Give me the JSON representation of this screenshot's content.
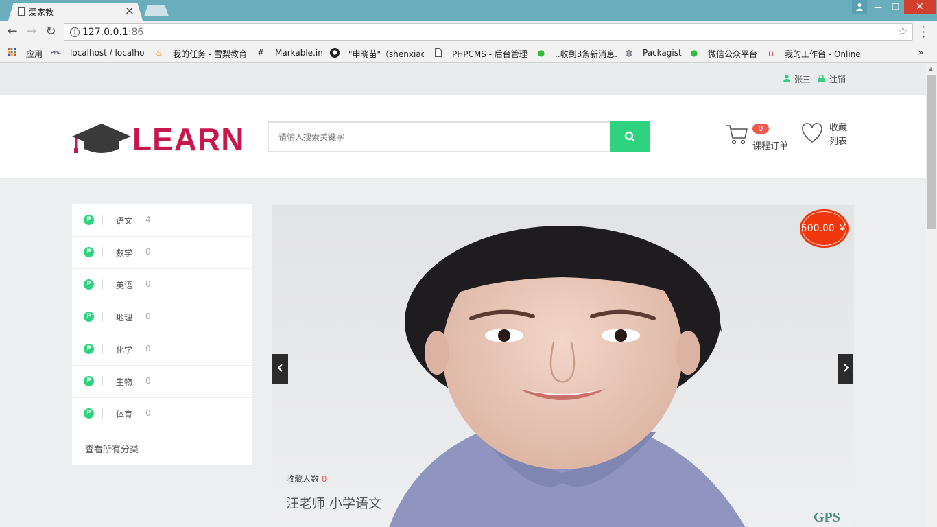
{
  "browser": {
    "tab_title": "爱家教",
    "url_host": "127.0.0.1",
    "url_port": ":86",
    "bookmarks": [
      {
        "label": "应用",
        "icon": "apps-grid-icon"
      },
      {
        "label": "localhost / localhos",
        "icon": "phpmyadmin-icon"
      },
      {
        "label": "我的任务 - 雪梨教育",
        "icon": "flame-icon"
      },
      {
        "label": "Markable.in",
        "icon": "hash-icon"
      },
      {
        "label": "\"申晓苗\"（shenxiao",
        "icon": "github-icon"
      },
      {
        "label": "PHPCMS - 后台管理",
        "icon": "page-icon"
      },
      {
        "label": "..收到3条新消息.",
        "icon": "wechat-icon"
      },
      {
        "label": "Packagist",
        "icon": "packagist-icon"
      },
      {
        "label": "微信公众平台",
        "icon": "wechat-icon"
      },
      {
        "label": "我的工作台 - Online",
        "icon": "online-icon"
      }
    ]
  },
  "topbar": {
    "username": "张三",
    "logout_label": "注销"
  },
  "header": {
    "logo_text": "LEARN",
    "search_placeholder": "请输入搜索关键字",
    "cart_count": "0",
    "cart_label": "课程订单",
    "favorites_label": "收藏列表"
  },
  "sidebar": {
    "categories": [
      {
        "name": "语文",
        "count": "4"
      },
      {
        "name": "数学",
        "count": "0"
      },
      {
        "name": "英语",
        "count": "0"
      },
      {
        "name": "地理",
        "count": "0"
      },
      {
        "name": "化学",
        "count": "0"
      },
      {
        "name": "生物",
        "count": "0"
      },
      {
        "name": "体育",
        "count": "0"
      }
    ],
    "view_all_label": "查看所有分类"
  },
  "slider": {
    "price": "500.00 ￥",
    "favorites_label": "收藏人数",
    "favorites_count": "0",
    "course_title": "汪老师 小学语文",
    "watermark": "GPS"
  },
  "colors": {
    "brand": "#c8174d",
    "accent_green": "#2fd27e",
    "badge_red": "#f2574f",
    "price_orange": "#f0380c",
    "titlebar": "#6aaebe"
  }
}
